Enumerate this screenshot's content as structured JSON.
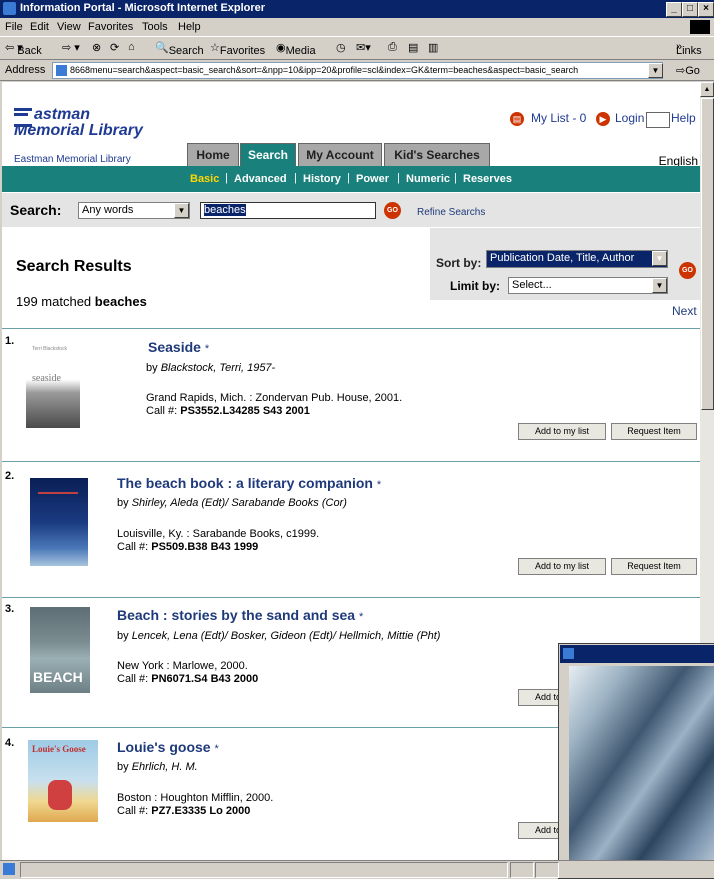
{
  "window": {
    "title": "Information Portal - Microsoft Internet Explorer"
  },
  "menu": [
    "File",
    "Edit",
    "View",
    "Favorites",
    "Tools",
    "Help"
  ],
  "toolbar": {
    "back": "Back",
    "search": "Search",
    "favorites": "Favorites",
    "media": "Media",
    "links": "Links"
  },
  "address": {
    "label": "Address",
    "value": "8668menu=search&aspect=basic_search&sort=&npp=10&ipp=20&profile=scl&index=GK&term=beaches&aspect=basic_search",
    "go": "Go"
  },
  "portal": {
    "logo_line1": "astman",
    "logo_line2": "Memorial Library",
    "library_name": "Eastman Memorial Library",
    "my_list": "My List - 0",
    "login": "Login",
    "help": "Help",
    "language": "English",
    "tabs": [
      "Home",
      "Search",
      "My Account",
      "Kid's Searches"
    ],
    "subnav": [
      "Basic",
      "Advanced",
      "History",
      "Power",
      "Numeric",
      "Reserves"
    ]
  },
  "search": {
    "label": "Search:",
    "type": "Any words",
    "term": "beaches",
    "go": "GO",
    "refine": "Refine Searchs"
  },
  "results": {
    "heading": "Search Results",
    "count_prefix": "199 matched",
    "count_term": "beaches",
    "sort_label": "Sort by:",
    "sort_value": "Publication Date, Title, Author",
    "limit_label": "Limit by:",
    "limit_value": "Select...",
    "next": "Next",
    "add_label": "Add to my list",
    "request_label": "Request Item",
    "items": [
      {
        "num": "1.",
        "title": "Seaside",
        "star": "*",
        "by": "by",
        "author": "Blackstock, Terri, 1957-",
        "pub": "Grand Rapids, Mich. : Zondervan Pub. House, 2001.",
        "call_label": "Call #:",
        "call": "PS3552.L34285 S43 2001",
        "cover_text": "seaside",
        "cover_author": "Terri Blackstock"
      },
      {
        "num": "2.",
        "title": "The beach book : a literary companion",
        "star": "*",
        "by": "by",
        "author": "Shirley, Aleda (Edt)/ Sarabande Books (Cor)",
        "pub": "Louisville, Ky. : Sarabande Books, c1999.",
        "call_label": "Call #:",
        "call": "PS509.B38 B43 1999",
        "cover_text": "",
        "cover_author": ""
      },
      {
        "num": "3.",
        "title": "Beach : stories by the sand and sea",
        "star": "*",
        "by": "by",
        "author": "Lencek, Lena (Edt)/ Bosker, Gideon (Edt)/ Hellmich, Mittie (Pht)",
        "pub": "New York : Marlowe, 2000.",
        "call_label": "Call #:",
        "call": "PN6071.S4 B43 2000",
        "cover_text": "BEACH",
        "cover_author": ""
      },
      {
        "num": "4.",
        "title": "Louie's goose",
        "star": "*",
        "by": "by",
        "author": "Ehrlich, H. M.",
        "pub": "Boston : Houghton Mifflin, 2000.",
        "call_label": "Call #:",
        "call": "PZ7.E3335 Lo 2000",
        "cover_text": "Louie's Goose",
        "cover_author": ""
      }
    ]
  }
}
